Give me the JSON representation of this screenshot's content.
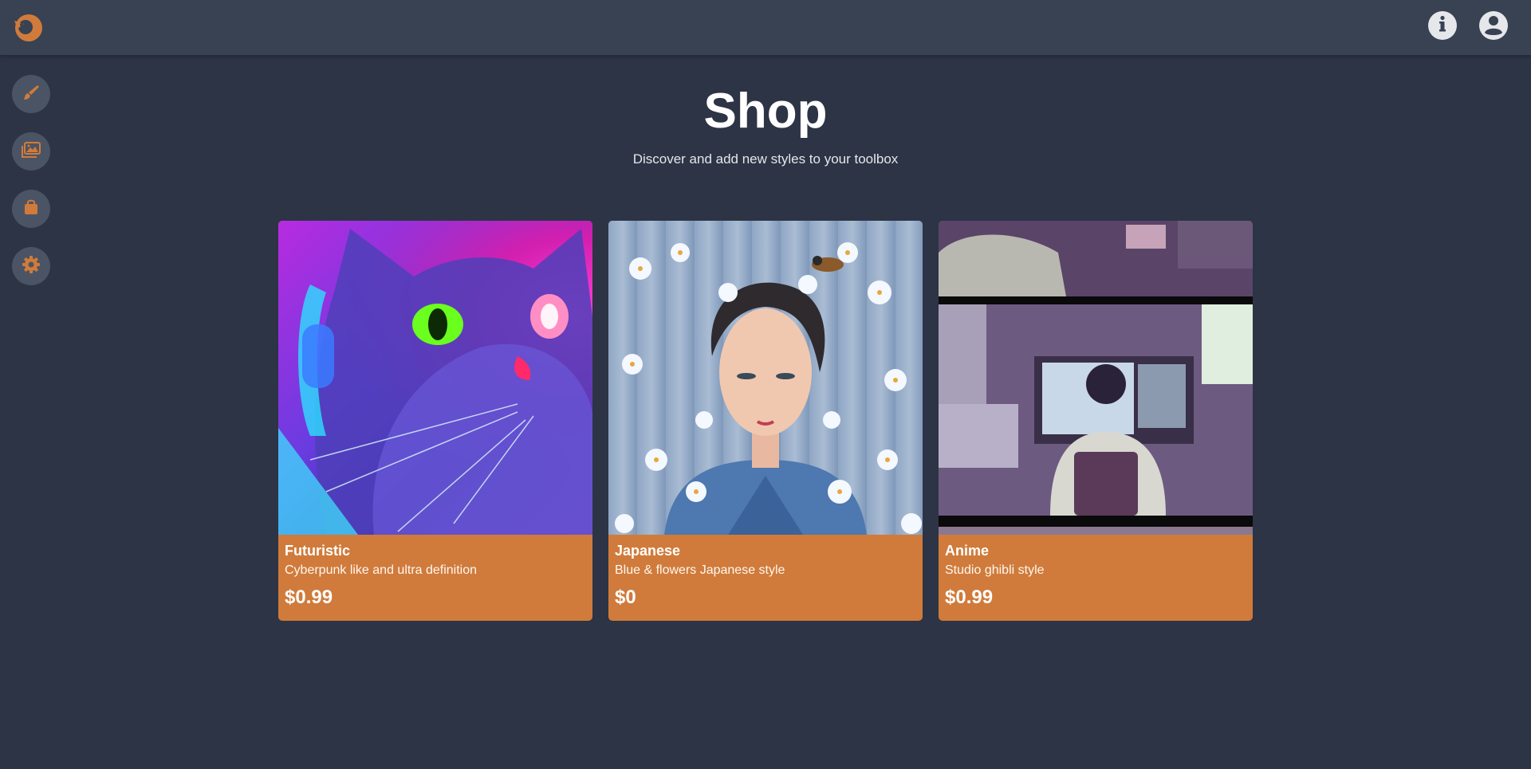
{
  "app": {
    "logo_icon": "fox-logo-icon",
    "accent": "#d07b3b",
    "background": "#2c3445",
    "topbar_bg": "#384253"
  },
  "topbar": {
    "icons": [
      {
        "name": "info-icon"
      },
      {
        "name": "user-account-icon"
      }
    ]
  },
  "sidebar": {
    "items": [
      {
        "icon": "paint-brush-icon"
      },
      {
        "icon": "gallery-images-icon"
      },
      {
        "icon": "shopping-bag-icon"
      },
      {
        "icon": "gear-icon"
      }
    ]
  },
  "page": {
    "title": "Shop",
    "subtitle": "Discover and add new styles to your toolbox"
  },
  "cards": [
    {
      "title": "Futuristic",
      "description": "Cyberpunk like and ultra definition",
      "price": "$0.99"
    },
    {
      "title": "Japanese",
      "description": "Blue & flowers Japanese style",
      "price": "$0"
    },
    {
      "title": "Anime",
      "description": "Studio ghibli style",
      "price": "$0.99"
    }
  ]
}
